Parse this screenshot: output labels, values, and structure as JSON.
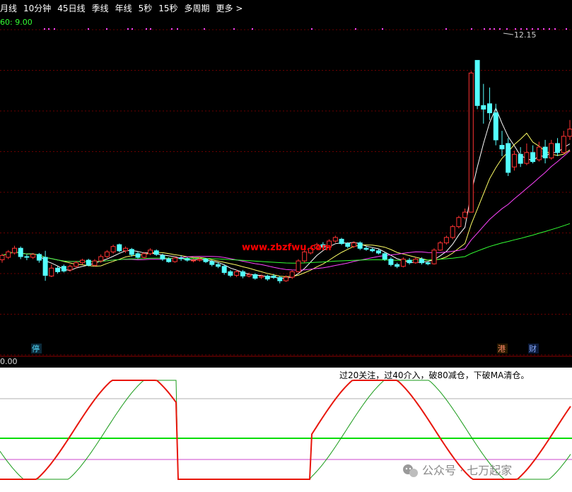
{
  "toolbar": {
    "tabs": [
      "月线",
      "10分钟",
      "45日线",
      "季线",
      "年线",
      "5秒",
      "15秒",
      "多周期",
      "更多 >"
    ]
  },
  "main_chart": {
    "indicator_text": "60: 9.00",
    "high_label": "12.15",
    "bottom_value": "0.00",
    "watermark": "www.zbzfwu.com",
    "markers": {
      "stop": "停",
      "harbor": "港",
      "finance": "财"
    },
    "colors": {
      "background": "#000000",
      "up": "#ff3232",
      "down": "#54ffff",
      "ma_short": "#ffffff",
      "ma_mid": "#ffff66",
      "ma_long": "#ff44ff",
      "ma_longest": "#33ff33",
      "grid": "#8b0000",
      "watermark": "#ff0000",
      "dots": "#ff44ff"
    }
  },
  "sub_chart": {
    "note": "过20关注，过40介入，破80减仓，下破MA清仓。",
    "watermark": "公众号 · 七万起家",
    "colors": {
      "background": "#ffffff",
      "main_line": "#e8160c",
      "signal_line": "#179a17",
      "level_green": "#00dd00",
      "level_magenta": "#cc44cc",
      "level_gray": "#b0b0b0"
    }
  },
  "chart_data": {
    "type": "candlestick",
    "candles": [
      {
        "o": 6.63,
        "c": 6.75,
        "h": 6.8,
        "l": 6.55
      },
      {
        "o": 6.7,
        "c": 6.85,
        "h": 6.9,
        "l": 6.65
      },
      {
        "o": 6.82,
        "c": 6.95,
        "h": 7.02,
        "l": 6.78
      },
      {
        "o": 6.95,
        "c": 6.72,
        "h": 7.0,
        "l": 6.65
      },
      {
        "o": 6.72,
        "c": 6.7,
        "h": 6.78,
        "l": 6.62
      },
      {
        "o": 6.7,
        "c": 6.78,
        "h": 6.82,
        "l": 6.65
      },
      {
        "o": 6.78,
        "c": 6.62,
        "h": 6.82,
        "l": 6.55
      },
      {
        "o": 6.7,
        "c": 6.2,
        "h": 6.88,
        "l": 6.05
      },
      {
        "o": 6.18,
        "c": 6.4,
        "h": 6.5,
        "l": 6.15
      },
      {
        "o": 6.4,
        "c": 6.3,
        "h": 6.45,
        "l": 6.25
      },
      {
        "o": 6.45,
        "c": 6.32,
        "h": 6.5,
        "l": 6.28
      },
      {
        "o": 6.35,
        "c": 6.45,
        "h": 6.5,
        "l": 6.3
      },
      {
        "o": 6.45,
        "c": 6.55,
        "h": 6.6,
        "l": 6.4
      },
      {
        "o": 6.55,
        "c": 6.62,
        "h": 6.66,
        "l": 6.5
      },
      {
        "o": 6.62,
        "c": 6.48,
        "h": 6.66,
        "l": 6.45
      },
      {
        "o": 6.48,
        "c": 6.6,
        "h": 6.65,
        "l": 6.45
      },
      {
        "o": 6.6,
        "c": 6.72,
        "h": 6.78,
        "l": 6.55
      },
      {
        "o": 6.72,
        "c": 6.85,
        "h": 6.9,
        "l": 6.68
      },
      {
        "o": 6.85,
        "c": 7.0,
        "h": 7.05,
        "l": 6.8
      },
      {
        "o": 7.05,
        "c": 6.88,
        "h": 7.08,
        "l": 6.84
      },
      {
        "o": 6.88,
        "c": 6.95,
        "h": 7.0,
        "l": 6.82
      },
      {
        "o": 6.92,
        "c": 6.78,
        "h": 6.96,
        "l": 6.72
      },
      {
        "o": 6.8,
        "c": 6.7,
        "h": 6.85,
        "l": 6.66
      },
      {
        "o": 6.7,
        "c": 6.8,
        "h": 6.85,
        "l": 6.66
      },
      {
        "o": 6.8,
        "c": 6.9,
        "h": 6.95,
        "l": 6.76
      },
      {
        "o": 6.88,
        "c": 6.78,
        "h": 6.92,
        "l": 6.74
      },
      {
        "o": 6.75,
        "c": 6.65,
        "h": 6.8,
        "l": 6.6
      },
      {
        "o": 6.65,
        "c": 6.58,
        "h": 6.7,
        "l": 6.55
      },
      {
        "o": 6.58,
        "c": 6.68,
        "h": 6.72,
        "l": 6.55
      },
      {
        "o": 6.68,
        "c": 6.66,
        "h": 6.75,
        "l": 6.6
      },
      {
        "o": 6.66,
        "c": 6.62,
        "h": 6.7,
        "l": 6.58
      },
      {
        "o": 6.62,
        "c": 6.62,
        "h": 6.66,
        "l": 6.56
      },
      {
        "o": 6.62,
        "c": 6.65,
        "h": 6.7,
        "l": 6.58
      },
      {
        "o": 6.65,
        "c": 6.58,
        "h": 6.68,
        "l": 6.54
      },
      {
        "o": 6.58,
        "c": 6.5,
        "h": 6.62,
        "l": 6.45
      },
      {
        "o": 6.5,
        "c": 6.45,
        "h": 6.55,
        "l": 6.4
      },
      {
        "o": 6.45,
        "c": 6.28,
        "h": 6.5,
        "l": 6.22
      },
      {
        "o": 6.3,
        "c": 6.2,
        "h": 6.35,
        "l": 6.15
      },
      {
        "o": 6.2,
        "c": 6.3,
        "h": 6.35,
        "l": 6.15
      },
      {
        "o": 6.3,
        "c": 6.18,
        "h": 6.35,
        "l": 6.12
      },
      {
        "o": 6.18,
        "c": 6.22,
        "h": 6.28,
        "l": 6.14
      },
      {
        "o": 6.22,
        "c": 6.12,
        "h": 6.26,
        "l": 6.08
      },
      {
        "o": 6.15,
        "c": 6.18,
        "h": 6.22,
        "l": 6.1
      },
      {
        "o": 6.18,
        "c": 6.1,
        "h": 6.22,
        "l": 6.05
      },
      {
        "o": 6.18,
        "c": 6.14,
        "h": 6.24,
        "l": 6.1
      },
      {
        "o": 6.14,
        "c": 6.05,
        "h": 6.18,
        "l": 5.98
      },
      {
        "o": 6.05,
        "c": 6.15,
        "h": 6.2,
        "l": 6.02
      },
      {
        "o": 6.15,
        "c": 6.3,
        "h": 6.35,
        "l": 6.1
      },
      {
        "o": 6.3,
        "c": 6.6,
        "h": 6.65,
        "l": 6.28
      },
      {
        "o": 6.6,
        "c": 6.85,
        "h": 6.9,
        "l": 6.55
      },
      {
        "o": 6.82,
        "c": 6.95,
        "h": 7.0,
        "l": 6.78
      },
      {
        "o": 6.95,
        "c": 7.05,
        "h": 7.1,
        "l": 6.9
      },
      {
        "o": 7.05,
        "c": 6.98,
        "h": 7.12,
        "l": 6.92
      },
      {
        "o": 6.98,
        "c": 7.15,
        "h": 7.2,
        "l": 6.95
      },
      {
        "o": 7.15,
        "c": 7.25,
        "h": 7.3,
        "l": 7.1
      },
      {
        "o": 7.2,
        "c": 7.08,
        "h": 7.24,
        "l": 7.04
      },
      {
        "o": 7.08,
        "c": 7.0,
        "h": 7.12,
        "l": 6.95
      },
      {
        "o": 7.0,
        "c": 7.1,
        "h": 7.14,
        "l": 6.96
      },
      {
        "o": 7.1,
        "c": 6.95,
        "h": 7.14,
        "l": 6.9
      },
      {
        "o": 6.95,
        "c": 6.92,
        "h": 7.0,
        "l": 6.88
      },
      {
        "o": 6.92,
        "c": 6.88,
        "h": 6.96,
        "l": 6.84
      },
      {
        "o": 6.88,
        "c": 6.82,
        "h": 6.92,
        "l": 6.78
      },
      {
        "o": 6.8,
        "c": 6.65,
        "h": 6.84,
        "l": 6.6
      },
      {
        "o": 6.65,
        "c": 6.5,
        "h": 6.7,
        "l": 6.45
      },
      {
        "o": 6.5,
        "c": 6.45,
        "h": 6.55,
        "l": 6.4
      },
      {
        "o": 6.45,
        "c": 6.65,
        "h": 6.7,
        "l": 6.42
      },
      {
        "o": 6.62,
        "c": 6.55,
        "h": 6.68,
        "l": 6.5
      },
      {
        "o": 6.55,
        "c": 6.65,
        "h": 6.7,
        "l": 6.52
      },
      {
        "o": 6.65,
        "c": 6.55,
        "h": 6.7,
        "l": 6.5
      },
      {
        "o": 6.55,
        "c": 6.52,
        "h": 6.6,
        "l": 6.48
      },
      {
        "o": 6.52,
        "c": 6.9,
        "h": 6.95,
        "l": 6.5
      },
      {
        "o": 6.9,
        "c": 7.1,
        "h": 7.15,
        "l": 6.88
      },
      {
        "o": 7.1,
        "c": 7.25,
        "h": 7.3,
        "l": 7.05
      },
      {
        "o": 7.25,
        "c": 7.55,
        "h": 7.6,
        "l": 7.2
      },
      {
        "o": 7.55,
        "c": 7.8,
        "h": 7.85,
        "l": 7.5
      },
      {
        "o": 7.8,
        "c": 7.95,
        "h": 8.05,
        "l": 7.75
      },
      {
        "o": 7.95,
        "c": 11.8,
        "h": 11.85,
        "l": 7.95
      },
      {
        "o": 12.15,
        "c": 10.9,
        "h": 12.15,
        "l": 10.8
      },
      {
        "o": 10.9,
        "c": 10.8,
        "h": 11.5,
        "l": 10.4
      },
      {
        "o": 10.95,
        "c": 10.7,
        "h": 11.4,
        "l": 10.5
      },
      {
        "o": 10.7,
        "c": 9.95,
        "h": 10.95,
        "l": 9.8
      },
      {
        "o": 9.8,
        "c": 9.7,
        "h": 10.2,
        "l": 9.5
      },
      {
        "o": 9.85,
        "c": 9.05,
        "h": 10.0,
        "l": 8.95
      },
      {
        "o": 9.2,
        "c": 9.55,
        "h": 9.65,
        "l": 9.1
      },
      {
        "o": 9.55,
        "c": 9.3,
        "h": 9.75,
        "l": 9.2
      },
      {
        "o": 9.3,
        "c": 9.6,
        "h": 9.85,
        "l": 9.25
      },
      {
        "o": 9.6,
        "c": 9.35,
        "h": 9.8,
        "l": 9.3
      },
      {
        "o": 9.4,
        "c": 9.75,
        "h": 9.9,
        "l": 9.35
      },
      {
        "o": 9.75,
        "c": 9.45,
        "h": 9.95,
        "l": 9.3
      },
      {
        "o": 9.45,
        "c": 9.85,
        "h": 9.95,
        "l": 9.4
      },
      {
        "o": 9.85,
        "c": 9.6,
        "h": 10.0,
        "l": 9.5
      },
      {
        "o": 9.6,
        "c": 10.05,
        "h": 10.2,
        "l": 9.55
      },
      {
        "o": 10.05,
        "c": 10.25,
        "h": 10.5,
        "l": 9.95
      }
    ],
    "ma_periods": [
      5,
      10,
      20,
      60
    ],
    "y_range": [
      4.0,
      13.0
    ],
    "grid": true
  }
}
